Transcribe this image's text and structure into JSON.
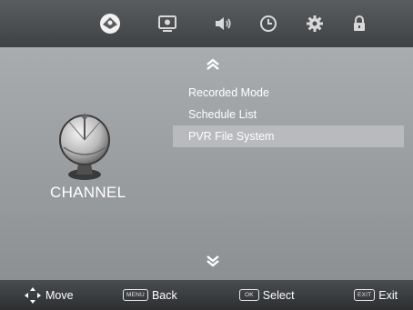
{
  "top_icons": [
    {
      "name": "channel-icon",
      "active": true
    },
    {
      "name": "picture-icon",
      "active": false
    },
    {
      "name": "sound-icon",
      "active": false
    },
    {
      "name": "time-icon",
      "active": false
    },
    {
      "name": "setup-icon",
      "active": false
    },
    {
      "name": "lock-icon",
      "active": false
    }
  ],
  "section": {
    "icon": "satellite-dish-icon",
    "label": "CHANNEL"
  },
  "menu": {
    "items": [
      {
        "label": "Recorded Mode",
        "selected": false
      },
      {
        "label": "Schedule List",
        "selected": false
      },
      {
        "label": "PVR File System",
        "selected": true
      }
    ]
  },
  "footer": {
    "move_label": "Move",
    "back_key": "MENU",
    "back_label": "Back",
    "select_key": "OK",
    "select_label": "Select",
    "exit_key": "EXIT",
    "exit_label": "Exit"
  },
  "colors": {
    "selected_row": "#b8babd",
    "text": "#ffffff"
  }
}
